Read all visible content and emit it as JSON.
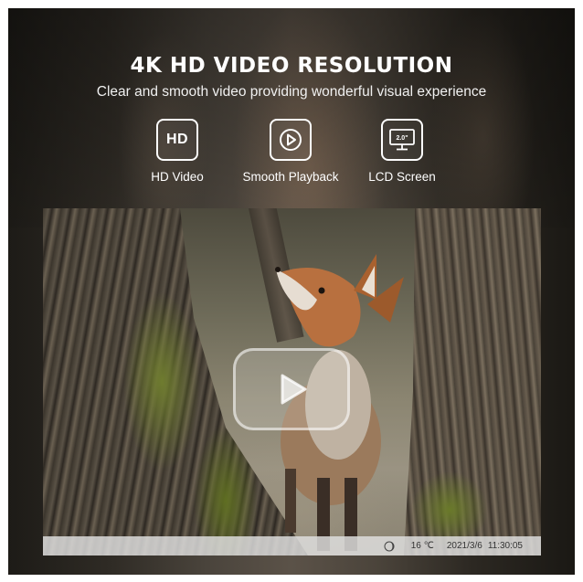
{
  "header": {
    "title": "4K HD VIDEO RESOLUTION",
    "subtitle": "Clear and smooth video providing wonderful visual experience"
  },
  "features": [
    {
      "icon": "hd-icon",
      "icon_text": "HD",
      "label": "HD Video"
    },
    {
      "icon": "play-icon",
      "label": "Smooth Playback"
    },
    {
      "icon": "lcd-screen-icon",
      "icon_text": "2.0\"",
      "label": "LCD Screen"
    }
  ],
  "photo": {
    "subject": "fox-between-trees",
    "status_bar": {
      "temperature": "16 ℃",
      "date": "2021/3/6",
      "time": "11:30:05"
    }
  },
  "colors": {
    "text": "#ffffff",
    "status_bar_bg": "#e1e1e1"
  }
}
